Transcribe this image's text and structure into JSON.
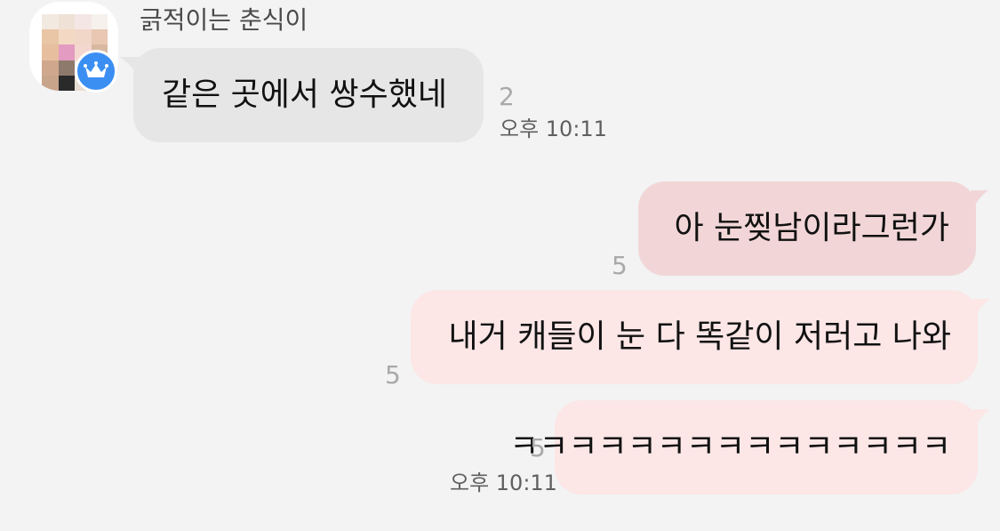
{
  "sender": {
    "name": "긁적이는 춘식이"
  },
  "messages": [
    {
      "direction": "incoming",
      "text": "같은 곳에서 쌍수했네",
      "unread_count": "2",
      "time": "오후 10:11"
    },
    {
      "direction": "outgoing",
      "text": "아 눈찢남이라그런가",
      "unread_count": "5"
    },
    {
      "direction": "outgoing",
      "text": "내거 캐들이 눈 다 똑같이 저러고 나와",
      "unread_count": "5"
    },
    {
      "direction": "outgoing",
      "text": "ㅋㅋㅋㅋㅋㅋㅋㅋㅋㅋㅋㅋㅋㅋㅋ",
      "unread_count": "5",
      "time": "오후 10:11"
    }
  ],
  "colors": {
    "background": "#f3f3f3",
    "incoming_bubble": "#e6e6e6",
    "outgoing_bubble": "#fce6e6",
    "outgoing_bubble_selected": "#f2d6d7",
    "badge": "#3b8ff3"
  },
  "icons": {
    "avatar": "pixelated-avatar",
    "badge": "crown-icon"
  }
}
